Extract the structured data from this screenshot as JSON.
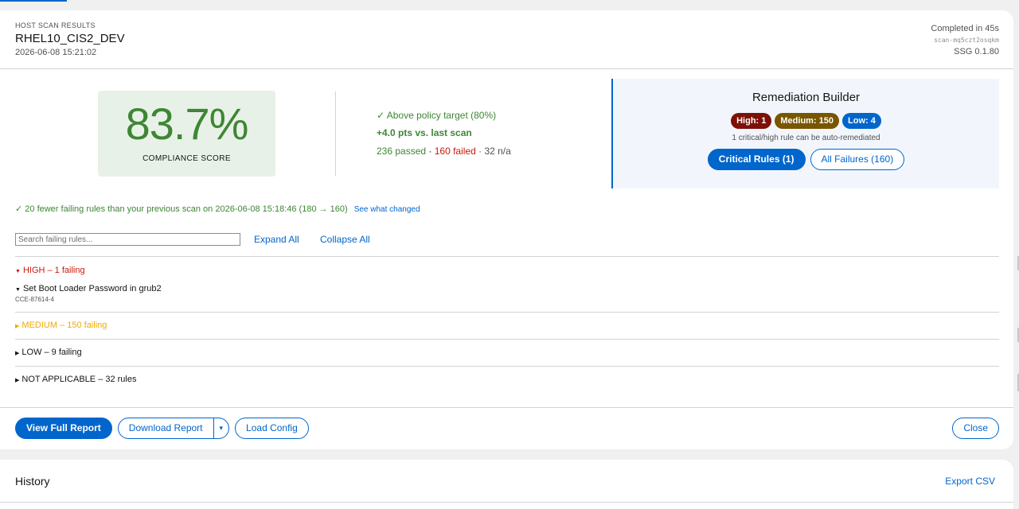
{
  "header": {
    "subtitle": "HOST SCAN RESULTS",
    "title": "RHEL10_CIS2_DEV",
    "date": "2026-06-08 15:21:02",
    "completed": "Completed in 45s",
    "scan_id": "scan-mq5czt2osqkm",
    "ssg": "SSG 0.1.80"
  },
  "score": {
    "value": "83.7%",
    "label": "COMPLIANCE SCORE"
  },
  "stats": {
    "target": "✓ Above policy target (80%)",
    "delta": "+4.0 pts vs. last scan",
    "passed": "236 passed",
    "sep1": " · ",
    "failed": "160 failed",
    "sep2": " · ",
    "na": "32 n/a"
  },
  "remediation": {
    "title": "Remediation Builder",
    "badges": {
      "high": "High: 1",
      "medium": "Medium: 150",
      "low": "Low: 4"
    },
    "note": "1 critical/high rule can be auto-remediated",
    "critical_btn": "Critical Rules (1)",
    "all_btn": "All Failures (160)"
  },
  "change": {
    "text": "✓  20 fewer failing rules than your previous scan on 2026-06-08 15:18:46 (180 → 160)",
    "link": "See what changed"
  },
  "search": {
    "placeholder": "Search failing rules..."
  },
  "controls": {
    "expand": "Expand All",
    "collapse": "Collapse All"
  },
  "severity": {
    "high": {
      "tri": "▼",
      "label": "HIGH – 1 failing"
    },
    "high_rule": {
      "tri": "▼",
      "name": "Set Boot Loader Password in grub2",
      "id": "CCE-87614-4"
    },
    "medium": {
      "tri": "▶",
      "label": "MEDIUM – 150 failing"
    },
    "low": {
      "tri": "▶",
      "label": "LOW – 9 failing"
    },
    "na": {
      "tri": "▶",
      "label": "NOT APPLICABLE – 32 rules"
    }
  },
  "footer": {
    "view": "View Full Report",
    "download": "Download Report",
    "download_toggle": "▾",
    "load": "Load Config",
    "close": "Close"
  },
  "history": {
    "title": "History",
    "export": "Export CSV"
  },
  "colors": {
    "accent": "#0066cc",
    "success": "#3e8635",
    "danger": "#c9190b",
    "warning": "#f0ab00"
  }
}
